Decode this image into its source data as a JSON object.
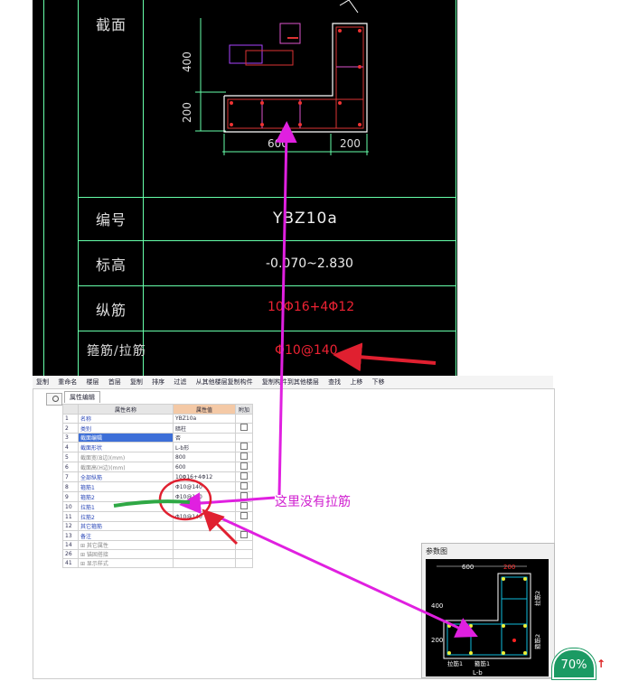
{
  "cad": {
    "labels": {
      "section": "截面",
      "number": "编号",
      "elevation": "标高",
      "long_rebar": "纵筋",
      "stirrup_tie": "箍筋/拉筋"
    },
    "dims": {
      "d400": "400",
      "d200v": "200",
      "d600": "600",
      "d200h": "200"
    },
    "values": {
      "number": "YBZ10a",
      "elevation": "-0.070~2.830",
      "long_rebar": "10Φ16+4Φ12",
      "stirrup": "Φ10@140"
    },
    "colors": {
      "accent_red": "#e02030",
      "annotation_magenta": "#d020d0",
      "cad_green": "#66ffaa"
    }
  },
  "toolbar": {
    "items": [
      "复制",
      "重命名",
      "楼层",
      "首层",
      "复制",
      "排序",
      "过滤",
      "从其他楼层复制构件",
      "复制构件到其他楼层",
      "查找",
      "上移",
      "下移"
    ]
  },
  "props": {
    "tab_label": "属性编辑",
    "headers": {
      "no": "",
      "name": "属性名称",
      "value": "属性值",
      "extra": "附加"
    },
    "rows": [
      {
        "no": "1",
        "name": "名称",
        "value": "YBZ10a",
        "style": "blue",
        "check": false
      },
      {
        "no": "2",
        "name": "类别",
        "value": "暗柱",
        "style": "blue",
        "check": true
      },
      {
        "no": "3",
        "name": "截面编辑",
        "value": "否",
        "style": "sel",
        "check": false
      },
      {
        "no": "4",
        "name": "截面形状",
        "value": "L-b形",
        "style": "blue",
        "check": true
      },
      {
        "no": "5",
        "name": "截面宽(B边)(mm)",
        "value": "800",
        "style": "gray",
        "check": true
      },
      {
        "no": "6",
        "name": "截面高(H边)(mm)",
        "value": "600",
        "style": "gray",
        "check": true
      },
      {
        "no": "7",
        "name": "全部纵筋",
        "value": "10Φ16+4Φ12",
        "style": "blue",
        "check": true
      },
      {
        "no": "8",
        "name": "箍筋1",
        "value": "Φ10@140",
        "style": "blue",
        "check": true
      },
      {
        "no": "9",
        "name": "箍筋2",
        "value": "Φ10@140",
        "style": "blue",
        "check": true
      },
      {
        "no": "10",
        "name": "拉筋1",
        "value": "",
        "style": "blue",
        "check": true
      },
      {
        "no": "11",
        "name": "拉筋2",
        "value": "Φ10@140",
        "style": "blue",
        "check": true
      },
      {
        "no": "12",
        "name": "其它箍筋",
        "value": "",
        "style": "blue",
        "check": false
      },
      {
        "no": "13",
        "name": "备注",
        "value": "",
        "style": "blue",
        "check": true
      },
      {
        "no": "14",
        "name": "⊞ 其它属性",
        "value": "",
        "style": "gray",
        "check": false
      },
      {
        "no": "26",
        "name": "⊞ 锚固搭接",
        "value": "",
        "style": "gray",
        "check": false
      },
      {
        "no": "41",
        "name": "⊞ 显示样式",
        "value": "",
        "style": "gray",
        "check": false
      }
    ]
  },
  "param": {
    "title": "参数图",
    "d600": "600",
    "d200": "200",
    "d400": "400",
    "d200b": "200",
    "tie1": "拉筋1",
    "stirrup1": "箍筋1",
    "tie2": "拉筋2",
    "stirrup2": "箍筋2",
    "shape": "L-b"
  },
  "annotation": {
    "note": "这里没有拉筋"
  },
  "zoom": {
    "level": "70%"
  }
}
